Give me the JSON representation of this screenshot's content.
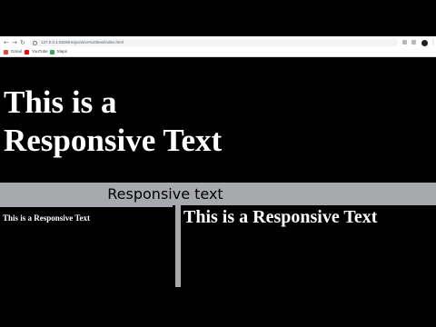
{
  "browser": {
    "address": "127.0.0.1:5500/responsive%20text/index.html",
    "back_icon": "←",
    "forward_icon": "→",
    "reload_icon": "↻",
    "menu_icon": "⋮",
    "bookmarks": [
      {
        "label": "Gmail",
        "color": "#ea4335"
      },
      {
        "label": "YouTube",
        "color": "#ff0000"
      },
      {
        "label": "Maps",
        "color": "#34a853"
      }
    ]
  },
  "main": {
    "big_title": "This is a Responsive Text",
    "banner_text": "Responsive text",
    "small_text": "This is a Responsive Text",
    "mid_text": "This is a Responsive Text"
  },
  "colors": {
    "background": "#000000",
    "banner": "#a7a9ad",
    "text": "#ffffff"
  }
}
